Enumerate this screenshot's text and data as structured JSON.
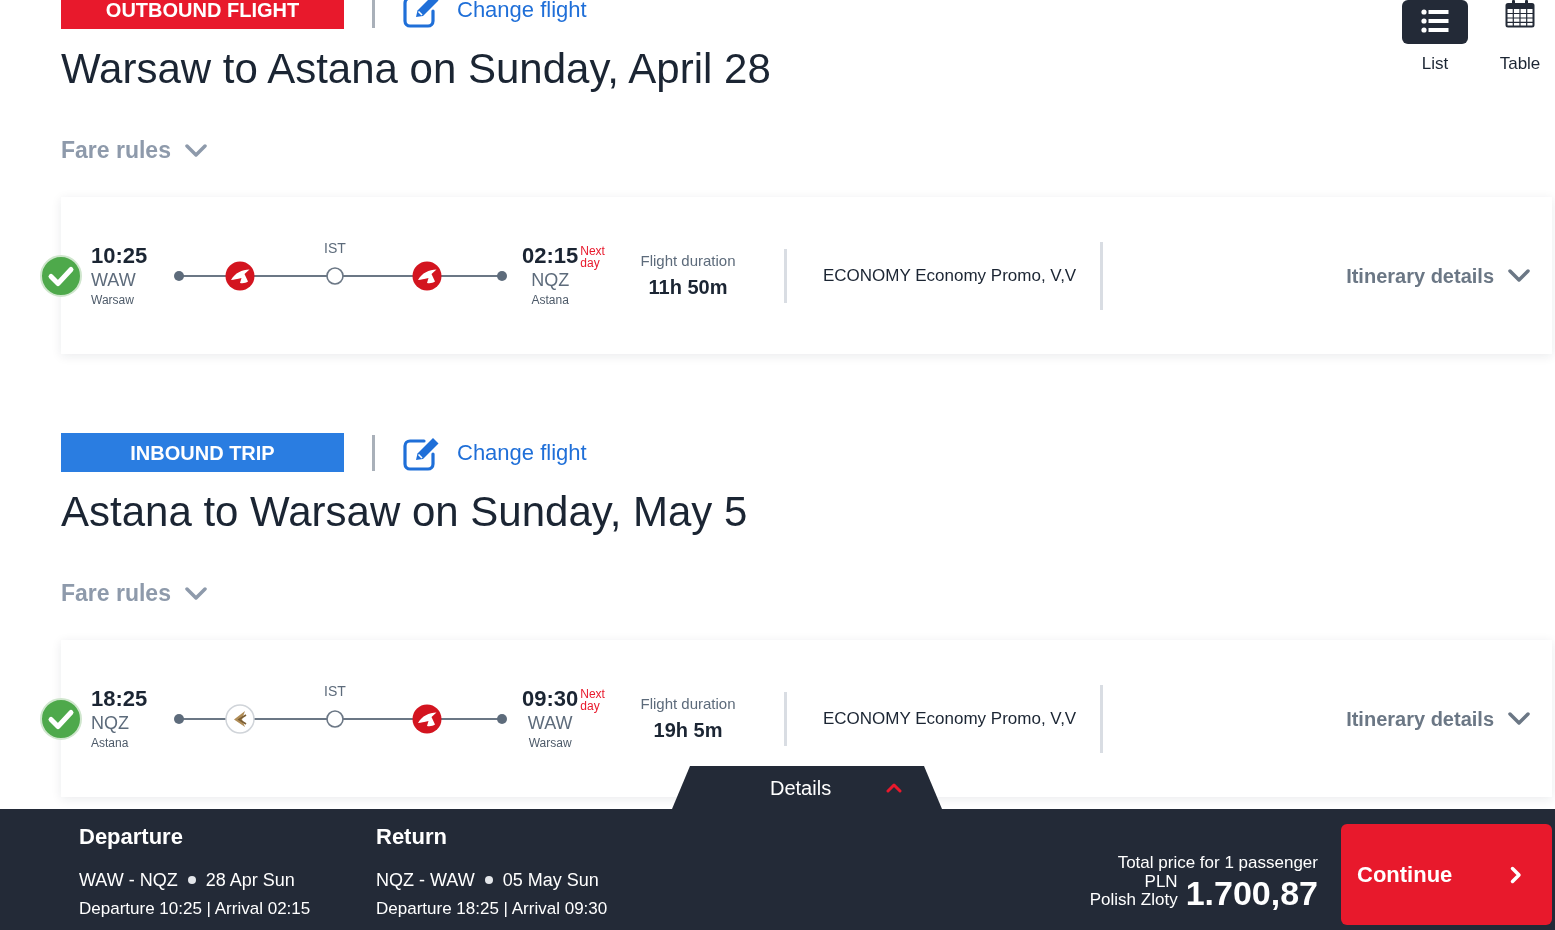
{
  "view_toggle": [
    {
      "kind": "list",
      "label": "List",
      "selected": true
    },
    {
      "kind": "table",
      "label": "Table",
      "selected": false
    }
  ],
  "sections": [
    {
      "badge": "OUTBOUND FLIGHT",
      "color": "#e8192c",
      "change_flight": "Change flight",
      "title": "Warsaw to Astana on Sunday, April 28",
      "fare_rules": {
        "label": "Fare rules",
        "expanded": false
      },
      "flight": {
        "selected": true,
        "departure": {
          "time": "10:25",
          "code": "WAW",
          "city": "Warsaw"
        },
        "route": [
          {
            "kind": "bird"
          },
          {
            "kind": "stop",
            "code": "IST"
          },
          {
            "kind": "bird"
          }
        ],
        "arrival": {
          "time": "02:15",
          "day_note": "Next day",
          "code": "NQZ",
          "city": "Astana"
        },
        "duration_label": "Flight duration",
        "duration": "11h 50m",
        "fare": "ECONOMY Economy Promo, V,V",
        "itinerary": {
          "label": "Itinerary details",
          "expanded": false
        }
      }
    },
    {
      "badge": "INBOUND TRIP",
      "color": "#2a7de1",
      "change_flight": "Change flight",
      "title": "Astana to Warsaw on Sunday, May 5",
      "fare_rules": {
        "label": "Fare rules",
        "expanded": false
      },
      "flight": {
        "selected": true,
        "departure": {
          "time": "18:25",
          "code": "NQZ",
          "city": "Astana"
        },
        "route": [
          {
            "kind": "wing"
          },
          {
            "kind": "stop",
            "code": "IST"
          },
          {
            "kind": "bird"
          }
        ],
        "arrival": {
          "time": "09:30",
          "day_note": "Next day",
          "code": "WAW",
          "city": "Warsaw"
        },
        "duration_label": "Flight duration",
        "duration": "19h 5m",
        "fare": "ECONOMY Economy Promo, V,V",
        "itinerary": {
          "label": "Itinerary details",
          "expanded": false
        }
      }
    }
  ],
  "details_tab": {
    "label": "Details",
    "expanded": false
  },
  "summary": {
    "trips": [
      {
        "heading": "Departure",
        "route": "WAW - NQZ",
        "date": "28 Apr Sun",
        "times": "Departure 10:25 | Arrival 02:15"
      },
      {
        "heading": "Return",
        "route": "NQZ - WAW",
        "date": "05 May Sun",
        "times": "Departure 18:25 | Arrival 09:30"
      }
    ],
    "total_label": "Total price for 1 passenger",
    "currency_code": "PLN",
    "currency_name": "Polish Zloty",
    "amount": "1.700,87",
    "continue_label": "Continue"
  }
}
